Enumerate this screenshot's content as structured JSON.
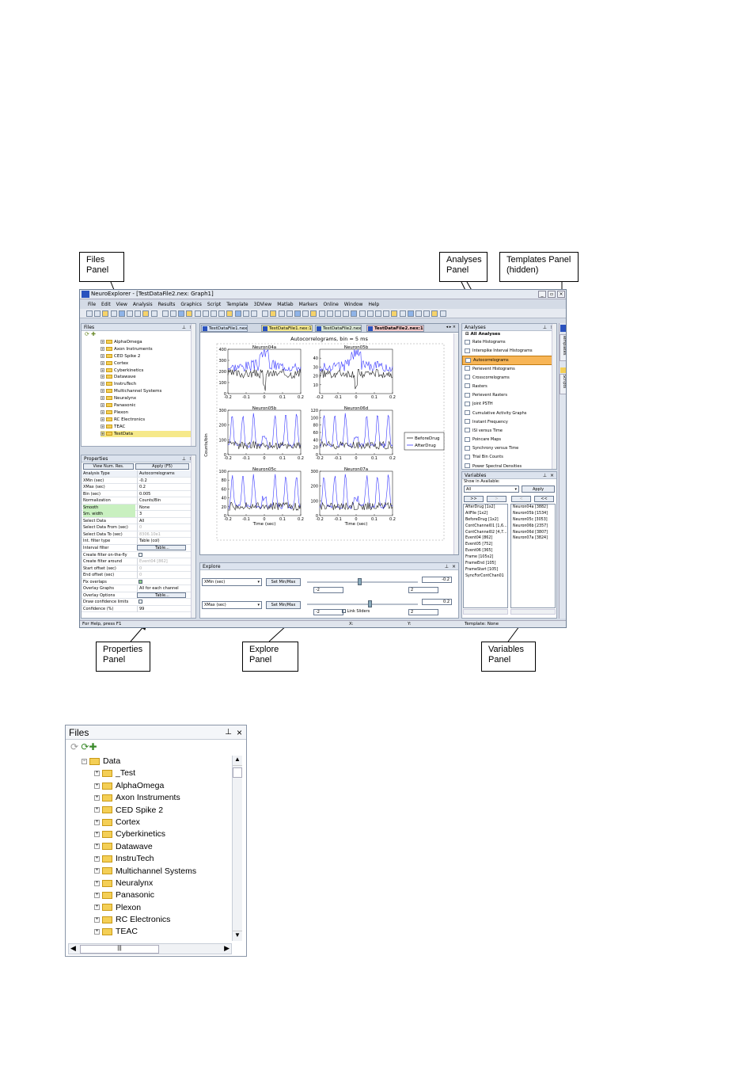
{
  "callouts": {
    "files": "Files\nPanel",
    "analyses": "Analyses\nPanel",
    "templates": "Templates Panel\n(hidden)",
    "properties": "Properties\nPanel",
    "explore": "Explore\nPanel",
    "variables": "Variables\nPanel"
  },
  "window": {
    "title": "NeuroExplorer - [TestDataFile2.nex: Graph1]",
    "menu": [
      "File",
      "Edit",
      "View",
      "Analysis",
      "Results",
      "Graphics",
      "Script",
      "Template",
      "3DView",
      "Matlab",
      "Markers",
      "Online",
      "Window",
      "Help"
    ],
    "status_left": "For Help, press F1",
    "status_x": "X:",
    "status_y": "Y:",
    "status_template": "Template: None"
  },
  "files_panel": {
    "title": "Files",
    "items": [
      "AlphaOmega",
      "Axon Instruments",
      "CED Spike 2",
      "Cortex",
      "Cyberkinetics",
      "Datawave",
      "InstruTech",
      "Multichannel Systems",
      "Neuralynx",
      "Panasonic",
      "Plexon",
      "RC Electronics",
      "TEAC",
      "TestData"
    ]
  },
  "properties_panel": {
    "title": "Properties",
    "btn_view": "View Num. Res.",
    "btn_apply": "Apply (F5)",
    "rows": [
      {
        "k": "Analysis Type",
        "v": "Autocorrelograms"
      },
      {
        "k": "XMin (sec)",
        "v": "-0.2"
      },
      {
        "k": "XMax (sec)",
        "v": "0.2"
      },
      {
        "k": "Bin (sec)",
        "v": "0.005"
      },
      {
        "k": "Normalization",
        "v": "Counts/Bin"
      },
      {
        "k": "Smooth",
        "v": "None"
      },
      {
        "k": "Sm. width",
        "v": "3"
      },
      {
        "k": "Select Data",
        "v": "All"
      },
      {
        "k": "Select Data From (sec)",
        "v": "0"
      },
      {
        "k": "Select Data To (sec)",
        "v": "8306.10e1"
      },
      {
        "k": "Int. filter type",
        "v": "Table (col)"
      },
      {
        "k": "Interval filter",
        "v": "Table..."
      },
      {
        "k": "Create filter on-the-fly",
        "v": ""
      },
      {
        "k": "Create filter around",
        "v": "Event04 [862]"
      },
      {
        "k": "Start offset (sec)",
        "v": "0"
      },
      {
        "k": "End offset (sec)",
        "v": "0"
      },
      {
        "k": "Fix overlaps",
        "v": ""
      },
      {
        "k": "Overlay Graphs",
        "v": "All for each channel"
      },
      {
        "k": "Overlay Options",
        "v": "Table..."
      },
      {
        "k": "Draw confidence limits",
        "v": ""
      },
      {
        "k": "Confidence (%)",
        "v": "99"
      }
    ]
  },
  "doc_tabs": [
    "TestDataFile1.nex",
    "TestDataFile1.nex:1",
    "TestDataFile2.nex",
    "TestDataFile2.nex:1"
  ],
  "chart_data": {
    "type": "line",
    "title": "Autocorrelograms, bin = 5 ms",
    "ylabel": "Counts/bin",
    "xlabel": "Time (sec)",
    "legend": [
      "BeforeDrug",
      "AfterDrug"
    ],
    "legend_position": "right",
    "xlim": [
      -0.2,
      0.2
    ],
    "xticks": [
      "-0.2",
      "-0.1",
      "0",
      "0.1",
      "0.2"
    ],
    "subplots": [
      {
        "name": "Neuron04a",
        "ylim": [
          0,
          400
        ],
        "yticks": [
          "0",
          "100",
          "200",
          "300",
          "400"
        ]
      },
      {
        "name": "Neuron05b",
        "ylim": [
          0,
          50
        ],
        "yticks": [
          "10",
          "20",
          "30",
          "40"
        ]
      },
      {
        "name": "Neuron05b",
        "ylim": [
          0,
          300
        ],
        "yticks": [
          "0",
          "100",
          "200",
          "300"
        ]
      },
      {
        "name": "Neuron06d",
        "ylim": [
          0,
          120
        ],
        "yticks": [
          "0",
          "20",
          "40",
          "60",
          "80",
          "100",
          "120"
        ]
      },
      {
        "name": "Neuron05c",
        "ylim": [
          0,
          100
        ],
        "yticks": [
          "0",
          "20",
          "40",
          "60",
          "80",
          "100"
        ]
      },
      {
        "name": "Neuron07a",
        "ylim": [
          0,
          300
        ],
        "yticks": [
          "0",
          "100",
          "200",
          "300"
        ]
      }
    ]
  },
  "explore_panel": {
    "title": "Explore",
    "xmin_select": "XMin (sec)",
    "xmax_select": "XMax (sec)",
    "set_btn": "Set Min/Max",
    "val1": "-0.2",
    "val2": "0.2",
    "neg2": "-2",
    "pos2": "2",
    "link": "Link Sliders"
  },
  "analyses_panel": {
    "title": "Analyses",
    "header": "All Analyses",
    "items": [
      "Rate Histograms",
      "Interspike Interval Histograms",
      "Autocorrelograms",
      "Perievent Histograms",
      "Crosscorrelograms",
      "Rasters",
      "Perievent Rasters",
      "Joint PSTH",
      "Cumulative Activity Graphs",
      "Instant Frequency",
      "ISI versus Time",
      "Poincare Maps",
      "Synchrony versus Time",
      "Trial Bin Counts",
      "Power Spectral Densities"
    ],
    "selected": "Autocorrelograms"
  },
  "variables_panel": {
    "title": "Variables",
    "show_label": "Show in Available:",
    "filter": "All",
    "apply": "Apply",
    "btns": [
      ">>",
      ">",
      "<",
      "<<"
    ],
    "available": [
      "AfterDrug [1x2]",
      "AllFile [1x2]",
      "BeforeDrug [1x2]",
      "ContChannel01 [1,6...",
      "ContChannel02 [4,7...",
      "Event04 [862]",
      "Event05 [752]",
      "Event06 [365]",
      "Frame [105x2]",
      "FrameEnd [105]",
      "FrameStart [105]",
      "SyncForContChan01"
    ],
    "selected": [
      "Neuron04a [3882]",
      "Neuron05b [1534]",
      "Neuron05c [3053]",
      "Neuron06b [2357]",
      "Neuron06d [3807]",
      "Neuron07a [3824]"
    ]
  },
  "side_tabs": [
    "Templates",
    "Scripts"
  ],
  "files_detail": {
    "title": "Files",
    "root": "Data",
    "items": [
      "_Test",
      "AlphaOmega",
      "Axon Instruments",
      "CED Spike 2",
      "Cortex",
      "Cyberkinetics",
      "Datawave",
      "InstruTech",
      "Multichannel Systems",
      "Neuralynx",
      "Panasonic",
      "Plexon",
      "RC Electronics",
      "TEAC"
    ]
  }
}
